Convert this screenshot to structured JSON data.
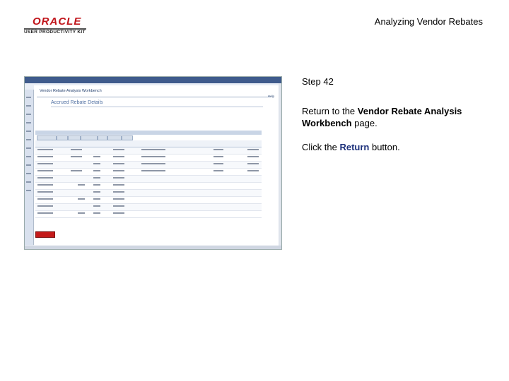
{
  "header": {
    "logo_word": "ORACLE",
    "logo_sub": "USER PRODUCTIVITY KIT",
    "title": "Analyzing Vendor Rebates"
  },
  "screenshot": {
    "workbench_title": "Vendor Rebate Analysis Workbench",
    "section_title": "Accrued Rebate Details",
    "help": "Help"
  },
  "instructions": {
    "step": "Step 42",
    "p1_a": "Return to the ",
    "p1_b": "Vendor Rebate Analysis Workbench",
    "p1_c": " page.",
    "p2_a": "Click the ",
    "p2_b": "Return",
    "p2_c": " button."
  },
  "colors": {
    "brand_red": "#c0141a",
    "link_blue": "#1b2f7a"
  }
}
